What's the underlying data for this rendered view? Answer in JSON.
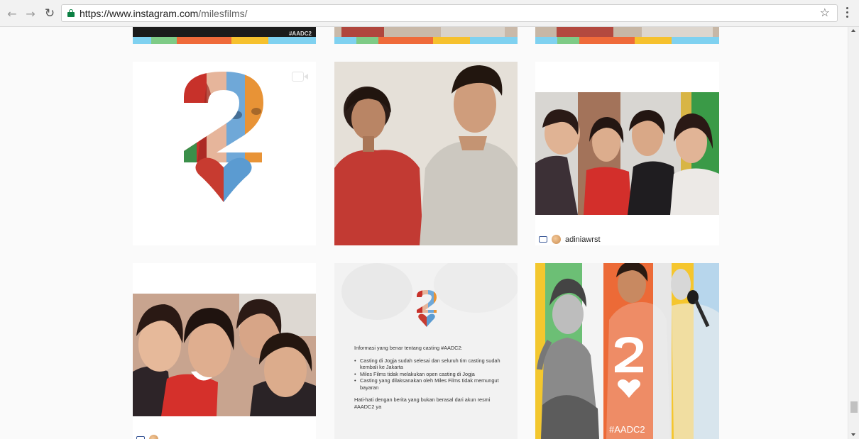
{
  "browser": {
    "url_host": "https://www.instagram.com",
    "url_path": "/milesfilms/",
    "back_icon": "arrow-left-icon",
    "forward_icon": "arrow-right-icon",
    "reload_icon": "reload-icon",
    "star_icon": "bookmark-star-icon",
    "menu_icon": "more-vertical-icon"
  },
  "posts": {
    "top_row_hashtag": "#AADC2",
    "post_4_credit": "adiniawrst",
    "post_8_intro": "Informasi yang benar tentang casting #AADC2:",
    "post_8_bullets": [
      "Casting di Jogja sudah selesai dan seluruh tim casting sudah kembali ke Jakarta",
      "Miles Films tidak melakukan open casting di Jogja",
      "Casting yang dilaksanakan oleh Miles Films tidak memungut bayaran"
    ],
    "post_8_warning": "Hati-hati  dengan berita yang bukan berasal dari akun resmi #AADC2 ya",
    "post_9_hashtag": "#AADC2"
  },
  "colors": {
    "stripe": [
      "#7fd1f0",
      "#7ecb86",
      "#ef6a3a",
      "#f6c12d",
      "#7fd1f0"
    ],
    "lock": "#0b8043"
  }
}
